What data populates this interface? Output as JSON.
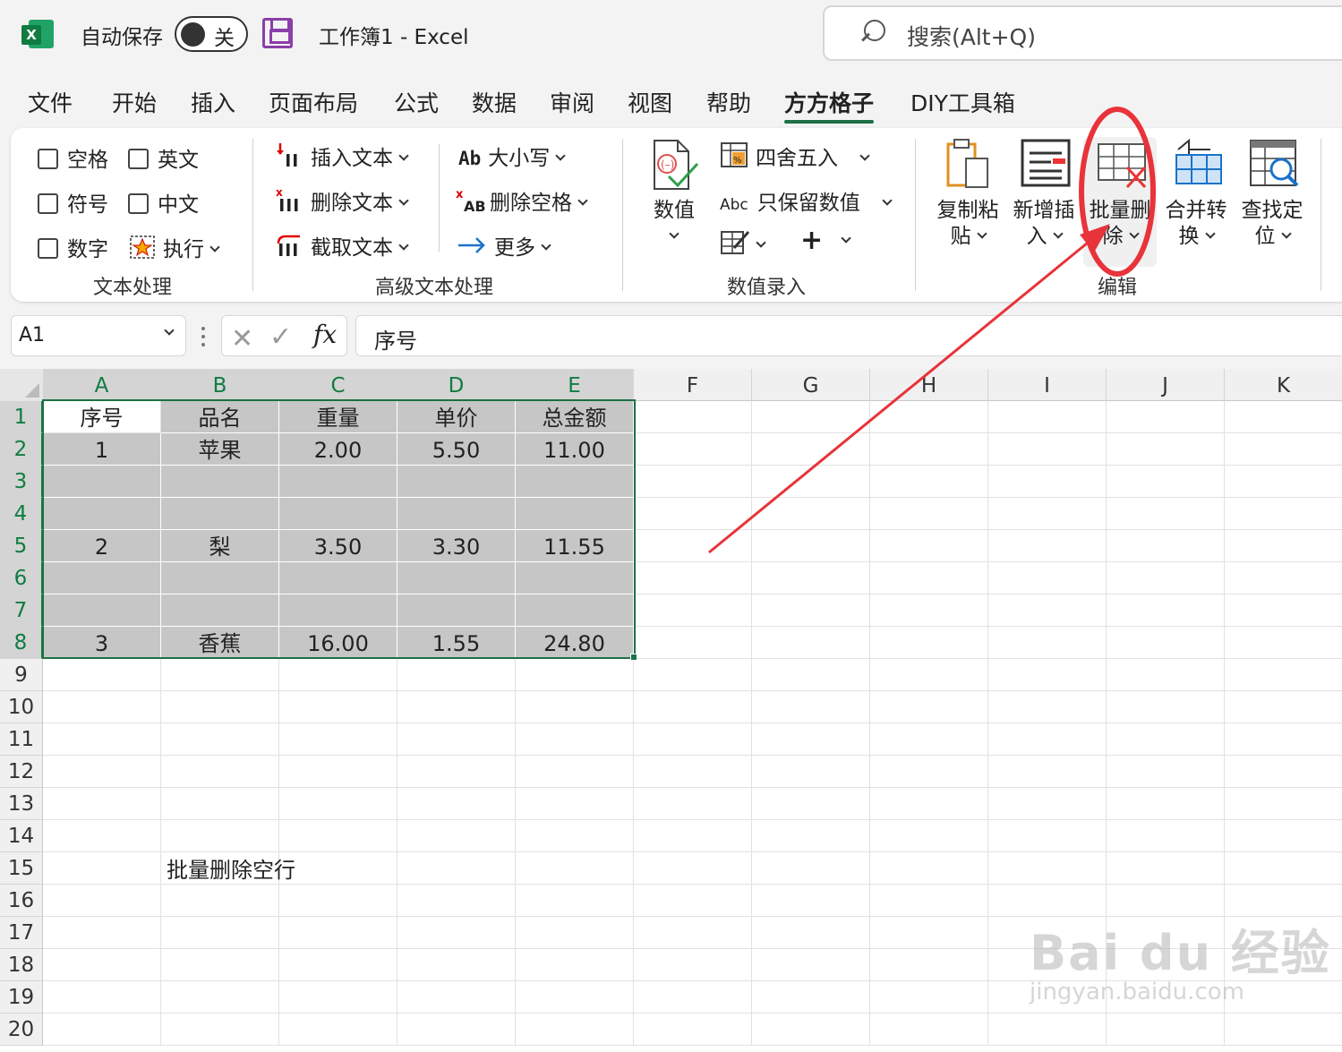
{
  "titlebar": {
    "autosave_label": "自动保存",
    "toggle_label": "关",
    "doc_title": "工作簿1  -  Excel",
    "search_placeholder": "搜索(Alt+Q)"
  },
  "tabs": [
    "文件",
    "开始",
    "插入",
    "页面布局",
    "公式",
    "数据",
    "审阅",
    "视图",
    "帮助",
    "方方格子",
    "DIY工具箱"
  ],
  "active_tab": "方方格子",
  "ribbon": {
    "text_group": {
      "label": "文本处理",
      "checks": [
        "空格",
        "英文",
        "符号",
        "中文",
        "数字"
      ],
      "execute": "执行"
    },
    "adv_group": {
      "label": "高级文本处理",
      "insert_text": "插入文本",
      "delete_text": "删除文本",
      "extract_text": "截取文本",
      "case": "大小写",
      "case_icon": "Ab",
      "delete_space": "删除空格",
      "more": "更多"
    },
    "num_group": {
      "label": "数值录入",
      "value": "数值",
      "round": "四舍五入",
      "keep_value": "只保留数值",
      "keep_icon": "Abc"
    },
    "edit_group": {
      "label": "编辑",
      "copy_paste": [
        "复制粘",
        "贴"
      ],
      "add_insert": [
        "新增插",
        "入"
      ],
      "batch_delete": [
        "批量删",
        "除"
      ],
      "merge_convert": [
        "合并转",
        "换"
      ],
      "find_locate": [
        "查找定",
        "位"
      ]
    }
  },
  "formula_bar": {
    "name_box": "A1",
    "fx_label": "fx",
    "content": "序号"
  },
  "grid": {
    "columns": [
      "A",
      "B",
      "C",
      "D",
      "E",
      "F",
      "G",
      "H",
      "I",
      "J",
      "K"
    ],
    "rows": [
      "1",
      "2",
      "3",
      "4",
      "5",
      "6",
      "7",
      "8",
      "9",
      "10",
      "11",
      "12",
      "13",
      "14",
      "15",
      "16",
      "17",
      "18",
      "19",
      "20"
    ],
    "table": [
      [
        "序号",
        "品名",
        "重量",
        "单价",
        "总金额"
      ],
      [
        "1",
        "苹果",
        "2.00",
        "5.50",
        "11.00"
      ],
      [
        "",
        "",
        "",
        "",
        ""
      ],
      [
        "",
        "",
        "",
        "",
        ""
      ],
      [
        "2",
        "梨",
        "3.50",
        "3.30",
        "11.55"
      ],
      [
        "",
        "",
        "",
        "",
        ""
      ],
      [
        "",
        "",
        "",
        "",
        ""
      ],
      [
        "3",
        "香蕉",
        "16.00",
        "1.55",
        "24.80"
      ]
    ],
    "note_text": "批量删除空行"
  },
  "watermark": {
    "line1": "Bai du 经验",
    "line2": "jingyan.baidu.com"
  },
  "colors": {
    "excel_green": "#1e7145",
    "annotation_red": "#e8333a",
    "selection_gray": "#c6c6c6"
  }
}
